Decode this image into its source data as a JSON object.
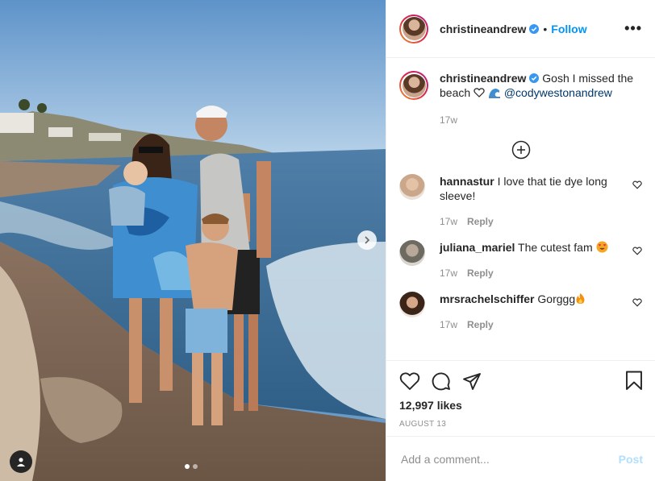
{
  "post": {
    "username": "christineandrew",
    "follow_label": "Follow",
    "bullet": "•",
    "more_label": "•••",
    "caption": {
      "text_start": "Gosh I missed the beach",
      "mention": "@codywestonandrew",
      "age": "17w"
    },
    "comments": [
      {
        "username": "hannastur",
        "text": "I love that tie dye long sleeve!",
        "age": "17w",
        "reply_label": "Reply"
      },
      {
        "username": "juliana_mariel",
        "text": "The cutest fam",
        "age": "17w",
        "reply_label": "Reply"
      },
      {
        "username": "mrsrachelschiffer",
        "text": "Gorggg",
        "age": "17w",
        "reply_label": "Reply"
      }
    ],
    "likes": "12,997 likes",
    "date": "AUGUST 13",
    "add_comment_placeholder": "Add a comment...",
    "post_label": "Post",
    "carousel": {
      "slide_count": 2,
      "active_slide": 1
    },
    "icons": {
      "like": "heart-icon",
      "comment": "comment-icon",
      "share": "share-icon",
      "save": "bookmark-icon",
      "load_more": "plus-circle-icon",
      "next": "chevron-right-icon",
      "tag": "user-tag-icon",
      "verified": "verified-badge-icon"
    },
    "colors": {
      "link": "#0095f6",
      "post_disabled": "#b2dffc",
      "muted": "#8e8e8e",
      "verified": "#3897f0"
    }
  }
}
